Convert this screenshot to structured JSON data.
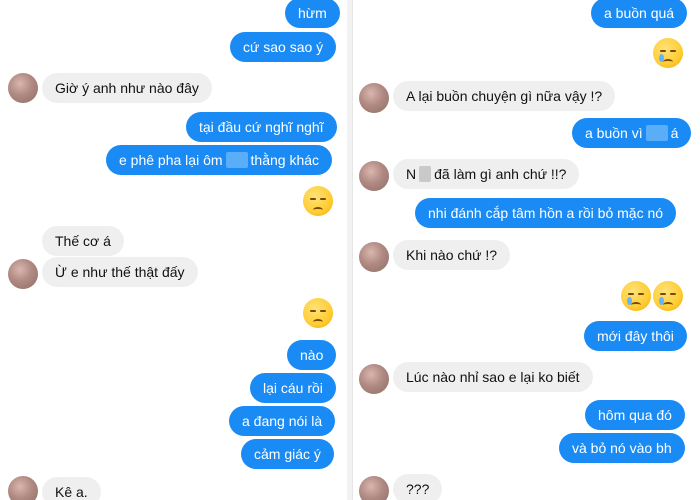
{
  "left_panel": {
    "messages": [
      {
        "text": "hừm"
      },
      {
        "text": "cứ sao sao ý"
      },
      {
        "text": "Giờ ý anh như nào đây"
      },
      {
        "text": "tại đầu cứ nghĩ nghĩ"
      },
      {
        "text_before": "e phê pha lại ôm",
        "text_after": "thằng khác"
      },
      {
        "text": "Thế cơ á"
      },
      {
        "text": "Ừ e như thế thật đấy"
      },
      {
        "text": "nào"
      },
      {
        "text": "lại cáu rồi"
      },
      {
        "text": "a đang nói là"
      },
      {
        "text": "cảm giác ý"
      },
      {
        "text": "Kê a."
      }
    ],
    "emojis": [
      "pensive-face-emoji",
      "pensive-face-emoji"
    ]
  },
  "right_panel": {
    "messages": [
      {
        "text": "a buồn quá"
      },
      {
        "text": "A lại buồn chuyện gì nữa  vậy !?"
      },
      {
        "text_before": "a buồn vì",
        "text_after": "á"
      },
      {
        "text_before": "N",
        "text_after": "đã làm gì anh chứ !!?"
      },
      {
        "text": "nhi đánh cắp tâm hồn a rồi bỏ mặc nó"
      },
      {
        "text": "Khi nào chứ !?"
      },
      {
        "text": "mới đây thôi"
      },
      {
        "text": "Lúc nào nhỉ sao e lại ko biết"
      },
      {
        "text": "hôm qua đó"
      },
      {
        "text": "và bỏ nó vào bh"
      },
      {
        "text": "???"
      }
    ],
    "emojis": [
      "sad-relieved-face-emoji",
      "sad-relieved-face-emoji",
      "sad-relieved-face-emoji"
    ]
  },
  "colors": {
    "outgoing_bubble": "#1a8bf5",
    "incoming_bubble": "#efefef"
  }
}
